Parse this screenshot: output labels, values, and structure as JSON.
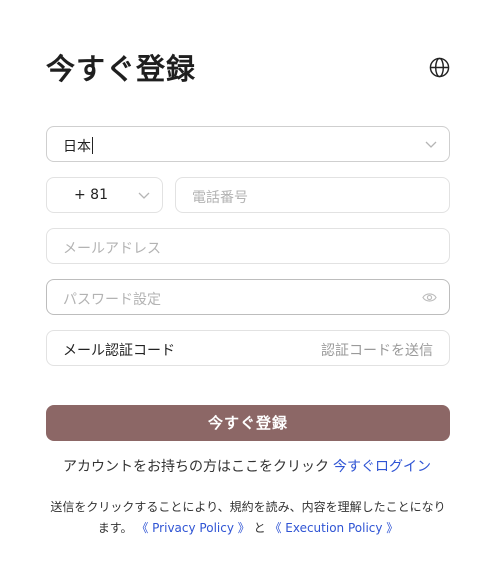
{
  "header": {
    "title": "今すぐ登録",
    "language_icon": "globe-icon"
  },
  "form": {
    "country_value": "日本",
    "country_code_value": "+ 81",
    "phone_placeholder": "電話番号",
    "email_placeholder": "メールアドレス",
    "password_placeholder": "パスワード設定",
    "verification_placeholder": "メール認証コード",
    "send_code_label": "認証コードを送信",
    "submit_label": "今すぐ登録"
  },
  "footer": {
    "have_account_text": "アカウントをお持ちの方はここをクリック",
    "login_link": "今すぐログイン",
    "terms_prefix": "送信をクリックすることにより、規約を読み、内容を理解したことになります。",
    "privacy_link": "《 Privacy Policy 》",
    "and_text": "と",
    "execution_link": "《 Execution Policy 》"
  },
  "colors": {
    "submit_bg": "#8c6766",
    "link": "#2f54d4",
    "border": "#e2e2e2"
  }
}
